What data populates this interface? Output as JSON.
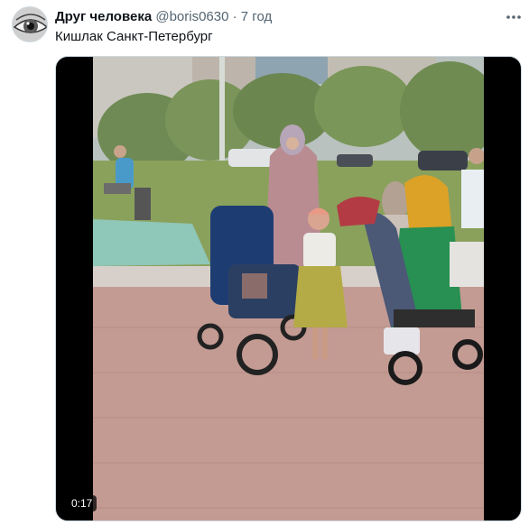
{
  "tweet": {
    "author_name": "Друг человека",
    "author_handle": "@boris0630",
    "separator": "·",
    "time": "7 год",
    "text": "Кишлак Санкт-Петербург"
  },
  "media": {
    "type": "video",
    "duration": "0:17"
  },
  "icons": {
    "more": "more-horizontal-icon"
  }
}
